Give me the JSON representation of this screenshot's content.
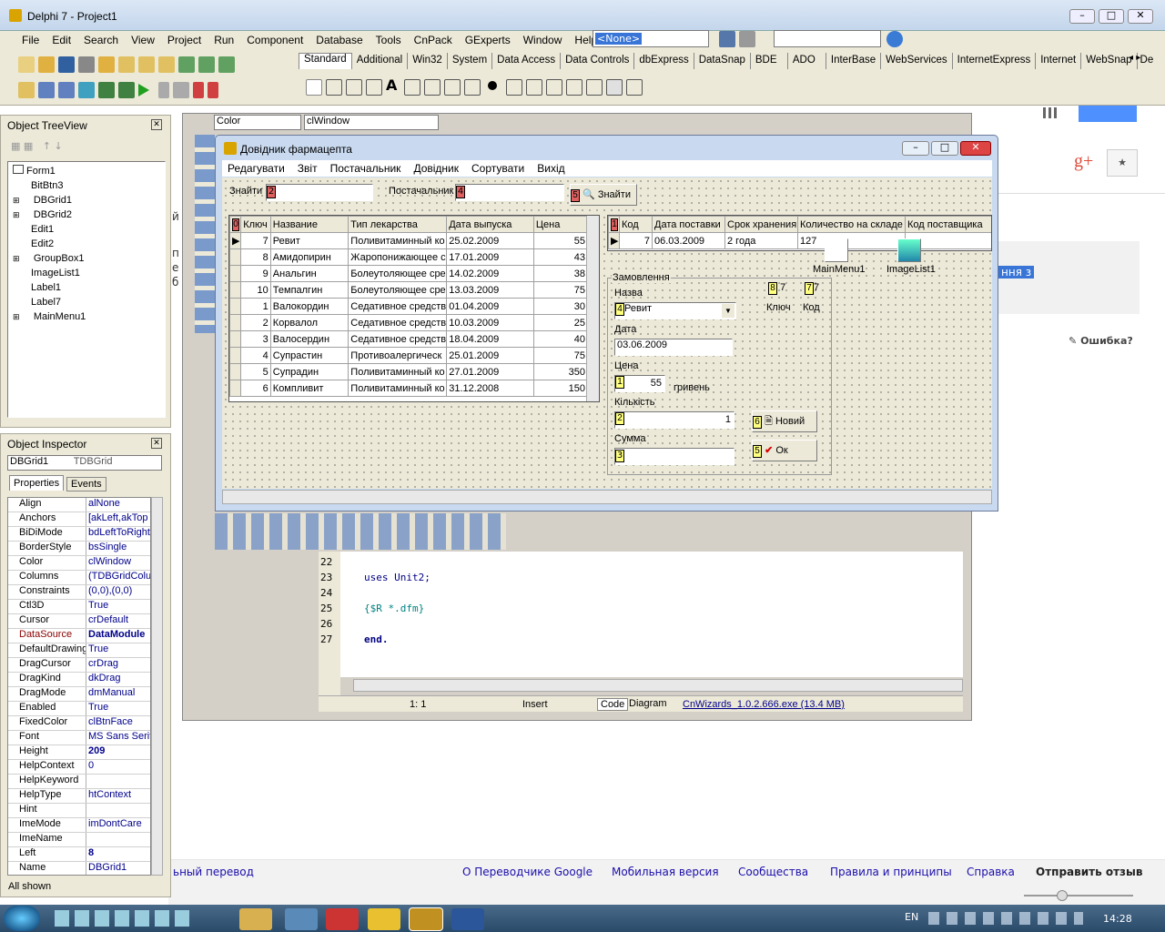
{
  "ide": {
    "title": "Delphi 7 - Project1",
    "menu": [
      "File",
      "Edit",
      "Search",
      "View",
      "Project",
      "Run",
      "Component",
      "Database",
      "Tools",
      "CnPack",
      "GExperts",
      "Window",
      "Help"
    ],
    "combo_value": "<None>",
    "palette_tabs": [
      "Standard",
      "Additional",
      "Win32",
      "System",
      "Data Access",
      "Data Controls",
      "dbExpress",
      "DataSnap",
      "BDE",
      "ADO",
      "InterBase",
      "WebServices",
      "InternetExpress",
      "Internet",
      "WebSnap",
      "De"
    ]
  },
  "tree": {
    "title": "Object TreeView",
    "items": [
      "Form1",
      "BitBtn3",
      "DBGrid1",
      "DBGrid2",
      "Edit1",
      "Edit2",
      "GroupBox1",
      "ImageList1",
      "Label1",
      "Label7",
      "MainMenu1"
    ]
  },
  "inspector": {
    "title": "Object Inspector",
    "object": "DBGrid1",
    "object_type": "TDBGrid",
    "tab_props": "Properties",
    "tab_events": "Events",
    "rows": [
      [
        "Align",
        "alNone"
      ],
      [
        "Anchors",
        "[akLeft,akTop"
      ],
      [
        "BiDiMode",
        "bdLeftToRight"
      ],
      [
        "BorderStyle",
        "bsSingle"
      ],
      [
        "Color",
        "clWindow"
      ],
      [
        "Columns",
        "(TDBGridColum"
      ],
      [
        "Constraints",
        "(0,0),(0,0)"
      ],
      [
        "Ctl3D",
        "True"
      ],
      [
        "Cursor",
        "crDefault"
      ],
      [
        "DataSource",
        "DataModule"
      ],
      [
        "DefaultDrawing",
        "True"
      ],
      [
        "DragCursor",
        "crDrag"
      ],
      [
        "DragKind",
        "dkDrag"
      ],
      [
        "DragMode",
        "dmManual"
      ],
      [
        "Enabled",
        "True"
      ],
      [
        "FixedColor",
        "clBtnFace"
      ],
      [
        "Font",
        "MS Sans Serif,"
      ],
      [
        "Height",
        "209"
      ],
      [
        "HelpContext",
        "0"
      ],
      [
        "HelpKeyword",
        ""
      ],
      [
        "HelpType",
        "htContext"
      ],
      [
        "Hint",
        ""
      ],
      [
        "ImeMode",
        "imDontCare"
      ],
      [
        "ImeName",
        ""
      ],
      [
        "Left",
        "8"
      ],
      [
        "Name",
        "DBGrid1"
      ]
    ],
    "status": "All shown"
  },
  "editor_bar": {
    "prop": "Color",
    "value": "clWindow"
  },
  "form": {
    "title": "Довідник фармацепта",
    "menu": [
      "Редагувати",
      "Звіт",
      "Постачальник",
      "Довідник",
      "Сортувати",
      "Вихід"
    ],
    "find_label": "Знайти",
    "supplier_label": "Постачальник",
    "find_button": "Знайти",
    "grid1": {
      "headers": [
        "Ключ",
        "Название",
        "Тип лекарства",
        "Дата выпуска",
        "Цена"
      ],
      "rows": [
        [
          "7",
          "Ревит",
          "Поливитаминный ко",
          "25.02.2009",
          "55"
        ],
        [
          "8",
          "Амидопирин",
          "Жаропонижающее с",
          "17.01.2009",
          "43"
        ],
        [
          "9",
          "Анальгин",
          "Болеутоляющее сре",
          "14.02.2009",
          "38"
        ],
        [
          "10",
          "Темпалгин",
          "Болеутоляющее сре",
          "13.03.2009",
          "75"
        ],
        [
          "1",
          "Валокордин",
          "Седативное средств",
          "01.04.2009",
          "30"
        ],
        [
          "2",
          "Корвалол",
          "Седативное средств",
          "10.03.2009",
          "25"
        ],
        [
          "3",
          "Валосердин",
          "Седативное средств",
          "18.04.2009",
          "40"
        ],
        [
          "4",
          "Супрастин",
          "Противоалергическ",
          "25.01.2009",
          "75"
        ],
        [
          "5",
          "Супрадин",
          "Поливитаминный ко",
          "27.01.2009",
          "350"
        ],
        [
          "6",
          "Компливит",
          "Поливитаминный ко",
          "31.12.2008",
          "150"
        ]
      ]
    },
    "grid2": {
      "headers": [
        "Код",
        "Дата поставки",
        "Срок хранения",
        "Количество на складе",
        "Код поставщика"
      ],
      "rows": [
        [
          "7",
          "06.03.2009",
          "2 года",
          "127",
          ""
        ]
      ]
    },
    "main_menu_label": "MainMenu1",
    "image_list_label": "ImageList1",
    "group": {
      "title": "Замовлення",
      "name_label": "Назва",
      "name_value": "Ревит",
      "date_label": "Дата",
      "date_value": "03.06.2009",
      "price_label": "Цена",
      "price_value": "55",
      "currency": "гривень",
      "qty_label": "Кількість",
      "qty_value": "1",
      "sum_label": "Сумма",
      "new_button": "Новий",
      "ok_button": "Ок",
      "key_label": "Ключ",
      "code_label": "Код",
      "key_value": "7",
      "code_value": "7"
    }
  },
  "code": {
    "lines": [
      [
        "22",
        ""
      ],
      [
        "23",
        "uses Unit2;"
      ],
      [
        "24",
        ""
      ],
      [
        "25",
        "{$R *.dfm}"
      ],
      [
        "26",
        ""
      ],
      [
        "27",
        "end."
      ]
    ],
    "pos": "1:  1",
    "mode": "Insert",
    "tab_code": "Code",
    "tab_diagram": "Diagram",
    "wizard": "CnWizards_1.0.2.666.exe (13.4 MB)"
  },
  "browser": {
    "error": "Ошибка?",
    "highlight": "ння з",
    "footer": [
      "ьный перевод",
      "О Переводчике Google",
      "Мобильная версия",
      "Сообщества",
      "Правила и принципы",
      "Справка",
      "Отправить отзыв"
    ],
    "left_frag": [
      "й",
      "п",
      "е",
      "б"
    ]
  },
  "taskbar": {
    "lang": "EN",
    "time": "14:28"
  },
  "colors": {
    "accent": "#3875d7",
    "tag_yellow": "#ffff80",
    "tag_red": "#e06060"
  }
}
